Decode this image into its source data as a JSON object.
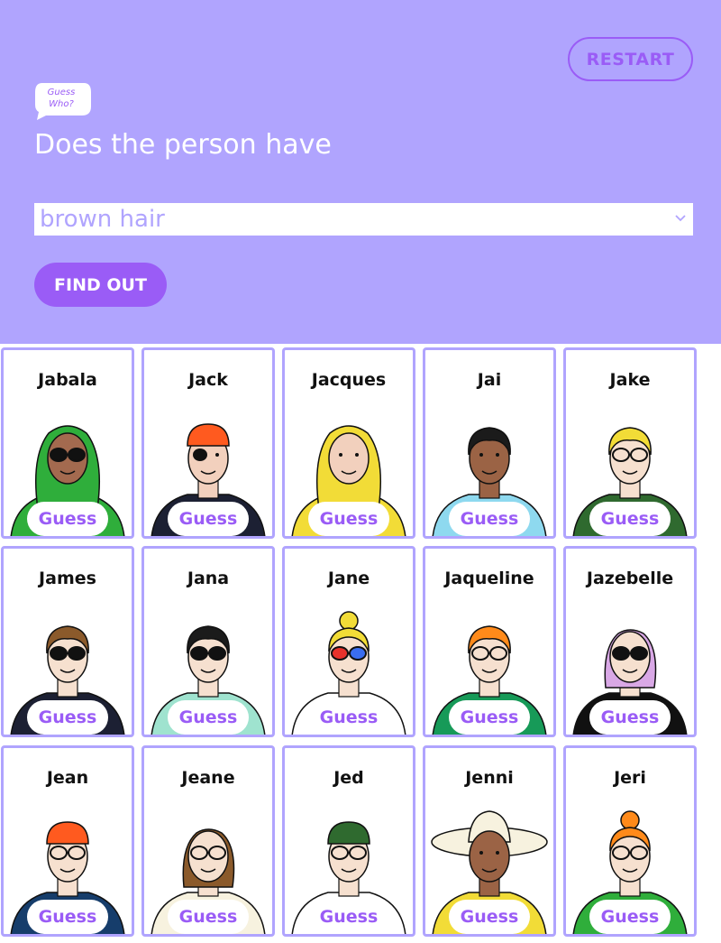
{
  "header": {
    "restart_label": "RESTART",
    "logo_text": "Guess Who?",
    "question": "Does the person have",
    "selected_option": "brown hair",
    "find_out_label": "FIND OUT"
  },
  "colors": {
    "header_bg": "#b0a4fe",
    "accent": "#9a5cf6",
    "card_border": "#b0a4fe"
  },
  "cards": [
    {
      "name": "Jabala",
      "guess_label": "Guess",
      "skin": "#a36a4f",
      "hair": "#2fae3b",
      "shirt": "#2fae3b",
      "hair_style": "hood",
      "glasses": "dark"
    },
    {
      "name": "Jack",
      "guess_label": "Guess",
      "skin": "#f2d0bd",
      "hair": "#ff5a1f",
      "shirt": "#1c2033",
      "hair_style": "bandana",
      "glasses": "patch"
    },
    {
      "name": "Jacques",
      "guess_label": "Guess",
      "skin": "#f2d0bd",
      "hair": "#f2dc37",
      "shirt": "#f2dc37",
      "hair_style": "hood",
      "glasses": "none"
    },
    {
      "name": "Jai",
      "guess_label": "Guess",
      "skin": "#9b6345",
      "hair": "#1b1b1b",
      "shirt": "#8ed9ef",
      "hair_style": "short",
      "glasses": "none"
    },
    {
      "name": "Jake",
      "guess_label": "Guess",
      "skin": "#f6e0cf",
      "hair": "#f2dc37",
      "shirt": "#2f6a2f",
      "hair_style": "short",
      "glasses": "clear"
    },
    {
      "name": "James",
      "guess_label": "Guess",
      "skin": "#f6e0cf",
      "hair": "#8b5a2b",
      "shirt": "#1c2033",
      "hair_style": "short",
      "glasses": "dark"
    },
    {
      "name": "Jana",
      "guess_label": "Guess",
      "skin": "#f6e0cf",
      "hair": "#1b1b1b",
      "shirt": "#9fe3cf",
      "hair_style": "short",
      "glasses": "dark"
    },
    {
      "name": "Jane",
      "guess_label": "Guess",
      "skin": "#f6e0cf",
      "hair": "#f2dc37",
      "shirt": "#ffffff",
      "hair_style": "bun",
      "glasses": "color"
    },
    {
      "name": "Jaqueline",
      "guess_label": "Guess",
      "skin": "#f6e0cf",
      "hair": "#ff8a1a",
      "shirt": "#179a58",
      "hair_style": "short",
      "glasses": "clear"
    },
    {
      "name": "Jazebelle",
      "guess_label": "Guess",
      "skin": "#f6e0cf",
      "hair": "#d9a8e6",
      "shirt": "#111111",
      "hair_style": "long",
      "glasses": "dark"
    },
    {
      "name": "Jean",
      "guess_label": "Guess",
      "skin": "#f6e0cf",
      "hair": "#ff5a1f",
      "shirt": "#163d6b",
      "hair_style": "beanie",
      "glasses": "clear"
    },
    {
      "name": "Jeane",
      "guess_label": "Guess",
      "skin": "#f6e0cf",
      "hair": "#8b5a2b",
      "shirt": "#f7f2df",
      "hair_style": "long",
      "glasses": "clear"
    },
    {
      "name": "Jed",
      "guess_label": "Guess",
      "skin": "#f6e0cf",
      "hair": "#2f6a2f",
      "shirt": "#ffffff",
      "hair_style": "beanie",
      "glasses": "clear"
    },
    {
      "name": "Jenni",
      "guess_label": "Guess",
      "skin": "#9b6345",
      "hair": "#f7f2df",
      "shirt": "#f2dc37",
      "hair_style": "hat",
      "glasses": "none"
    },
    {
      "name": "Jeri",
      "guess_label": "Guess",
      "skin": "#f6e0cf",
      "hair": "#ff8a1a",
      "shirt": "#2fae3b",
      "hair_style": "bun",
      "glasses": "clear"
    }
  ]
}
